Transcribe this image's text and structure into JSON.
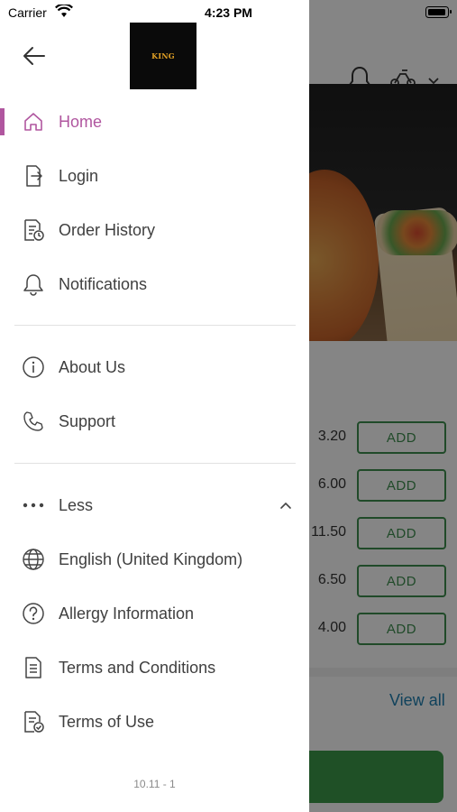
{
  "status_bar": {
    "carrier": "Carrier",
    "time": "4:23 PM"
  },
  "drawer": {
    "logo_text": "KING",
    "menu_primary": [
      {
        "label": "Home",
        "icon": "home-icon",
        "active": true
      },
      {
        "label": "Login",
        "icon": "login-icon",
        "active": false
      },
      {
        "label": "Order History",
        "icon": "order-history-icon",
        "active": false
      },
      {
        "label": "Notifications",
        "icon": "bell-icon",
        "active": false
      }
    ],
    "menu_secondary": [
      {
        "label": "About Us",
        "icon": "info-icon"
      },
      {
        "label": "Support",
        "icon": "phone-icon"
      }
    ],
    "less_toggle": {
      "label": "Less",
      "icon": "more-dots-icon",
      "expanded": true
    },
    "menu_more": [
      {
        "label": "English (United Kingdom)",
        "icon": "globe-icon"
      },
      {
        "label": "Allergy Information",
        "icon": "question-icon"
      },
      {
        "label": "Terms and Conditions",
        "icon": "document-icon"
      },
      {
        "label": "Terms of Use",
        "icon": "document-check-icon"
      }
    ],
    "version": "10.11 - 1"
  },
  "background": {
    "prices": [
      "3.20",
      "6.00",
      "11.50",
      "6.50",
      "4.00"
    ],
    "add_label": "ADD",
    "view_all": "View all"
  },
  "colors": {
    "accent": "#b0569f",
    "add_green": "#3f8f4f",
    "link_blue": "#1f7fb0",
    "logo_gold": "#e2a125"
  }
}
